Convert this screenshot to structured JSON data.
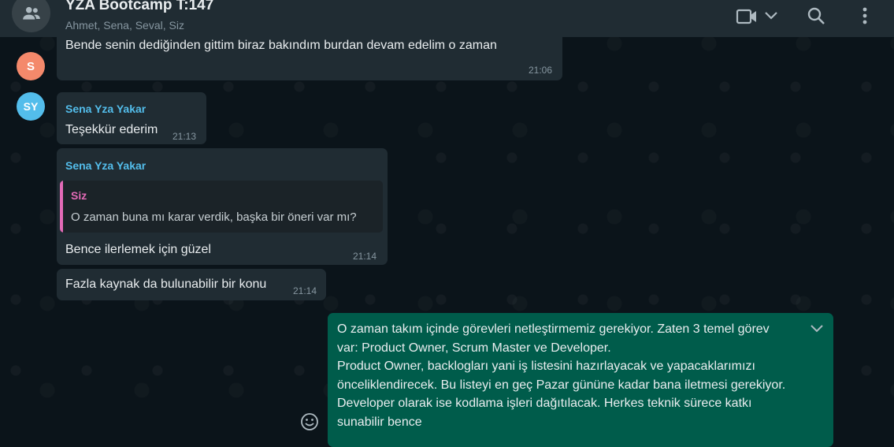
{
  "header": {
    "title": "YZA Bootcamp T:147",
    "participants": "Ahmet, Sena, Seval, Siz",
    "icons": [
      "group-avatar-icon",
      "video-call-icon",
      "chevron-down-icon",
      "search-icon",
      "menu-icon"
    ]
  },
  "messages": [
    {
      "avatar": "S",
      "avatar_color": "#f4896b",
      "text": "Bende senin dediğinden gittim biraz bakındım burdan devam edelim o zaman",
      "time": "21:06"
    },
    {
      "avatar": "SY",
      "avatar_color": "#53bdeb",
      "sender": "Sena Yza Yakar",
      "text": "Teşekkür ederim",
      "time": "21:13"
    },
    {
      "sender": "Sena Yza Yakar",
      "quote": {
        "author": "Siz",
        "text": "O zaman buna mı karar verdik, başka bir öneri var mı?"
      },
      "text": "Bence ilerlemek için güzel",
      "time": "21:14"
    },
    {
      "text": "Fazla kaynak da bulunabilir bir konu",
      "time": "21:14"
    }
  ],
  "outgoing": {
    "lines": [
      "O zaman takım içinde görevleri netleştirmemiz gerekiyor. Zaten 3 temel görev",
      "var: Product Owner, Scrum Master ve Developer.",
      "Product Owner, backlogları yani iş listesini hazırlayacak ve yapacaklarımızı",
      "önceliklendirecek. Bu listeyi en geç Pazar gününe kadar bana iletmesi gerekiyor.",
      "Developer olarak ise kodlama işleri dağıtılacak. Herkes teknik sürece katkı",
      "sunabilir bence"
    ]
  },
  "colors": {
    "background": "#0b141a",
    "header": "#202c33",
    "incoming_bubble": "#202c33",
    "outgoing_bubble": "#005c4b",
    "sender_name": "#53bdeb",
    "quote_author": "#e26ab6"
  }
}
